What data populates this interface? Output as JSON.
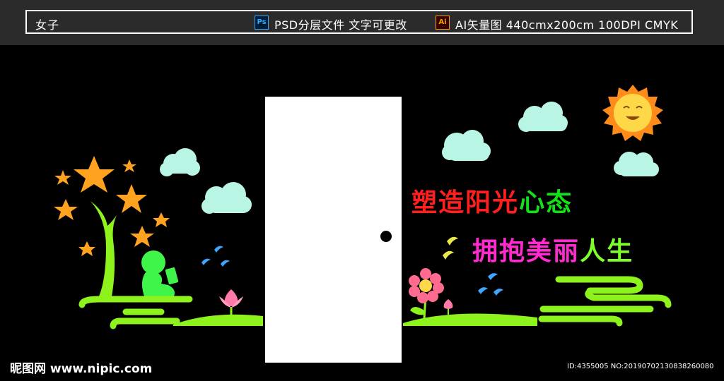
{
  "header": {
    "title": "女子",
    "ps_badge": "Ps",
    "psd_info": "PSD分层文件 文字可更改",
    "ai_badge": "Ai",
    "ai_info": "AI矢量图 440cmx200cm 100DPI CMYK"
  },
  "artwork": {
    "slogan_line1": [
      "塑",
      "造",
      "阳",
      "光",
      "心",
      "态"
    ],
    "slogan_line2": [
      "拥",
      "抱",
      "美",
      "丽",
      "人",
      "生"
    ],
    "slogan_colors_line1": [
      "#ff1f1f",
      "#ff1f1f",
      "#ff1f1f",
      "#ff1f1f",
      "#14e01a",
      "#14e01a"
    ],
    "slogan_colors_line2": [
      "#ff2bd0",
      "#ff2bd0",
      "#ff2bd0",
      "#ff2bd0",
      "#7dff2a",
      "#7dff2a"
    ],
    "colors": {
      "star": "#ffa21f",
      "cloud": "#b8f5e4",
      "grass": "#8ef21c",
      "boy": "#3ff54a",
      "bird": "#3da6ff",
      "bird_yellow": "#e8e84a",
      "sun": "#ff8c1a",
      "sun_face": "#ffd84a",
      "flower_pink": "#ff7aa8",
      "flower_center": "#ffd94a",
      "door": "#ffffff"
    }
  },
  "watermark": {
    "left": "昵图网 www.nipic.com",
    "right": "ID:4355005 NO:20190702130838260080"
  }
}
